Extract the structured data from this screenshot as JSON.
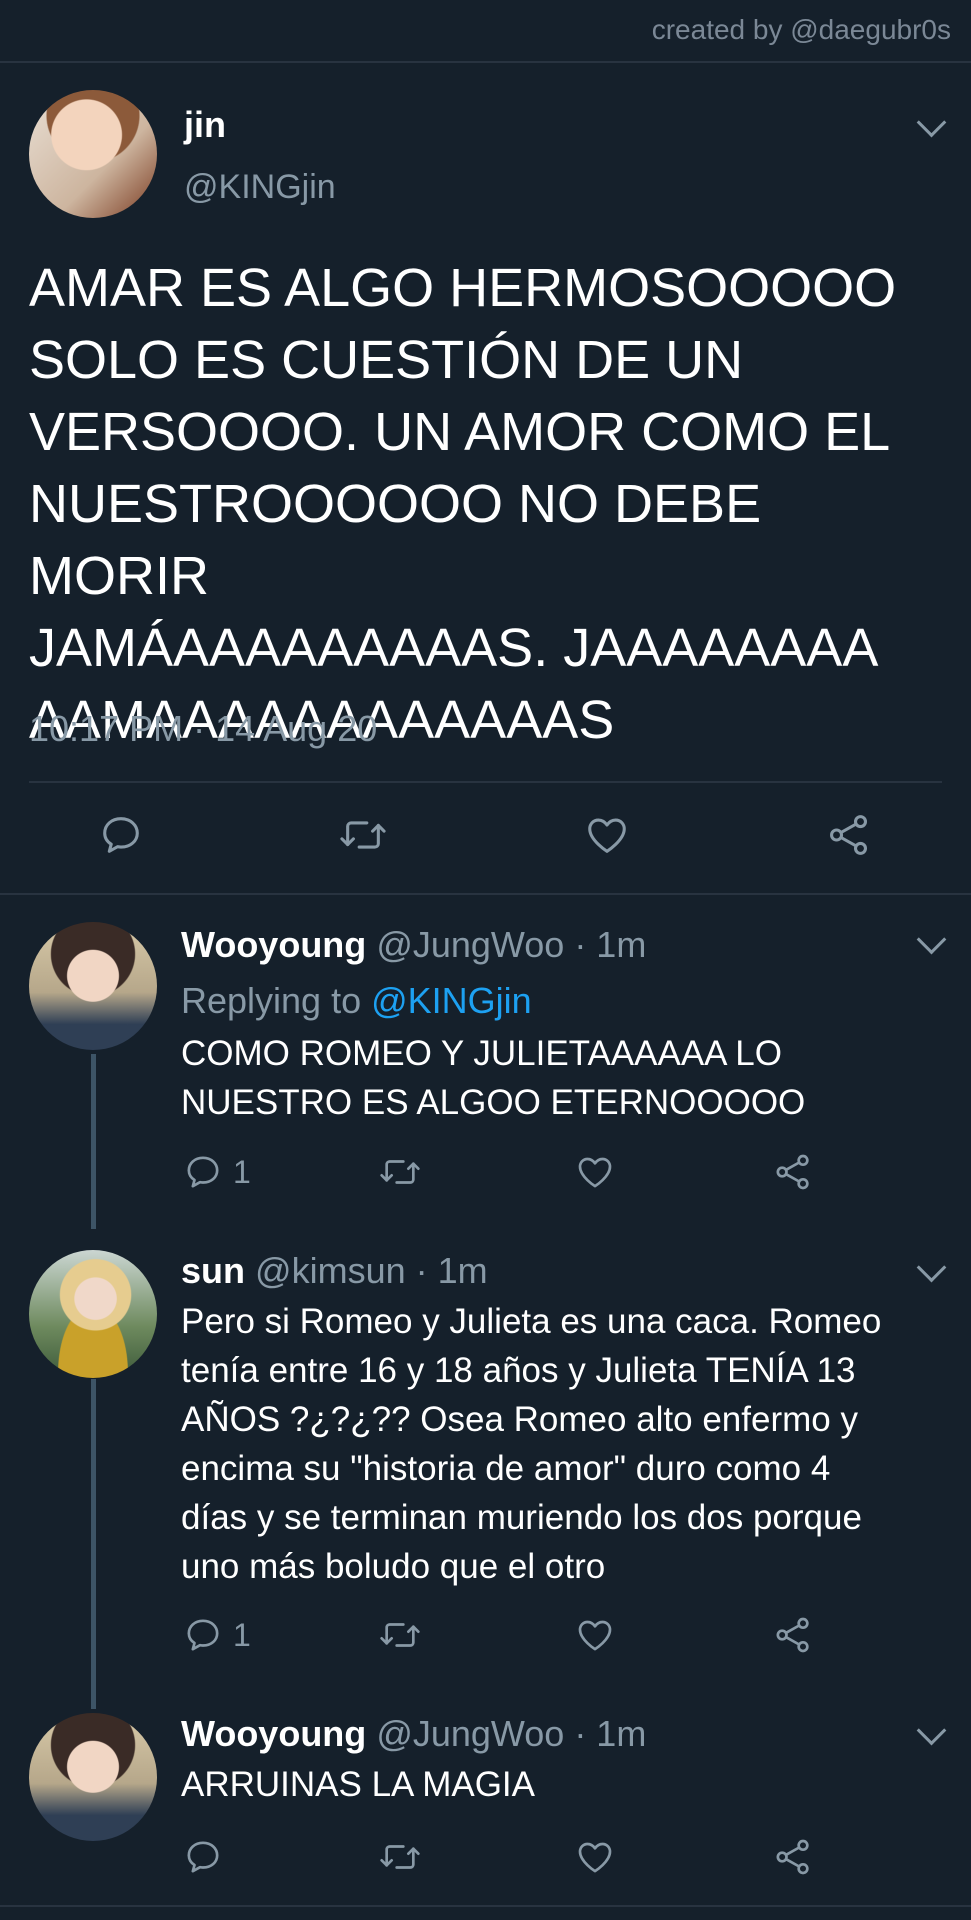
{
  "credit": "created by @daegubr0s",
  "main_tweet": {
    "name": "jin",
    "handle": "@KINGjin",
    "text": "AMAR ES ALGO HERMOSOOOOO\nSOLO ES CUESTIÓN DE UN\nVERSOOOO. UN AMOR COMO EL\nNUESTROOOOOO NO DEBE MORIR\nJAMÁAAAAAAAAAS. JAAAAAAAA\nAAMAAAAAAAAAAAAS",
    "timestamp": "10:17 PM · 14 Aug 20",
    "icons": [
      "reply-icon",
      "retweet-icon",
      "like-icon",
      "share-icon"
    ]
  },
  "replies": [
    {
      "name": "Wooyoung",
      "handle": "@JungWoo",
      "time": "· 1m",
      "replying_prefix": "Replying to",
      "replying_to": "@KINGjin",
      "text": "COMO ROMEO Y JULIETAAAAAA LO\nNUESTRO ES ALGOO ETERNOOOOO",
      "reply_count": "1"
    },
    {
      "name": "sun",
      "handle": "@kimsun",
      "time": "· 1m",
      "text": "Pero si Romeo y Julieta es una caca. Romeo\ntenía entre 16 y 18 años y Julieta TENÍA 13\nAÑOS ?¿?¿?? Osea Romeo alto enfermo y\nencima su \"historia de amor\" duro como 4\ndías y se terminan muriendo los dos porque\nuno más boludo que el otro",
      "reply_count": "1"
    },
    {
      "name": "Wooyoung",
      "handle": "@JungWoo",
      "time": "· 1m",
      "text": "ARRUINAS LA MAGIA",
      "reply_count": ""
    }
  ],
  "colors": {
    "background": "#15202b",
    "muted": "#8899a6",
    "link": "#1da1f2",
    "divider": "#283340"
  }
}
